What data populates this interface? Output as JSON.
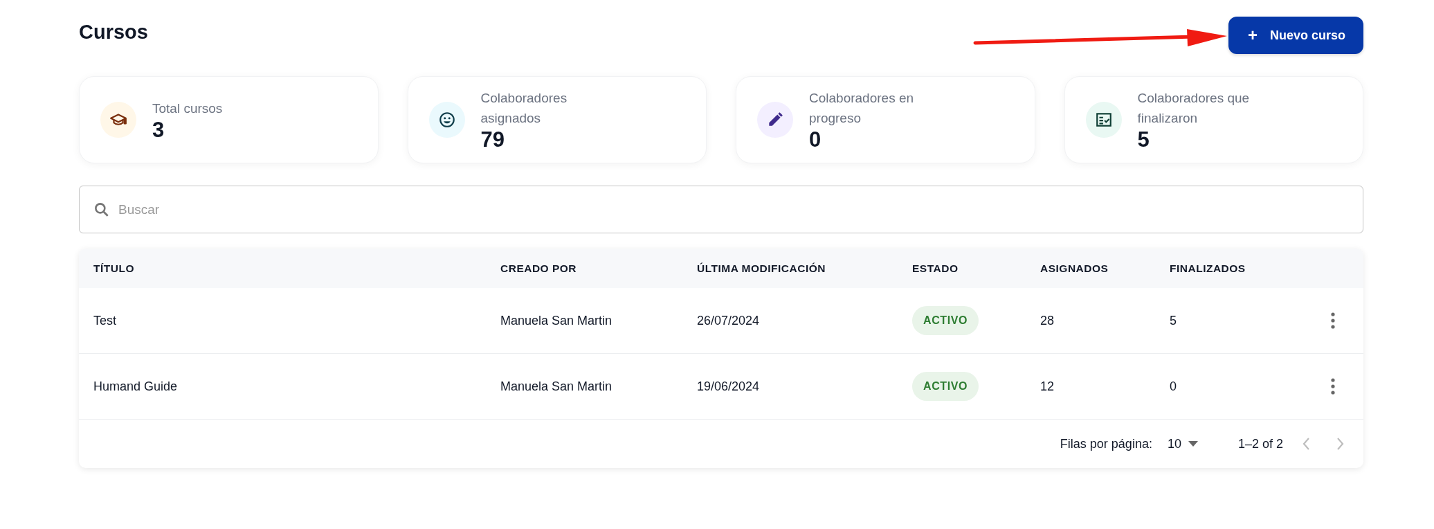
{
  "page": {
    "title": "Cursos",
    "new_button": {
      "icon": "+",
      "label": "Nuevo curso"
    }
  },
  "stats": [
    {
      "kind": "courses",
      "label": "Total cursos",
      "value": "3"
    },
    {
      "kind": "assigned",
      "label": "Colaboradores asignados",
      "value": "79"
    },
    {
      "kind": "in_progress",
      "label": "Colaboradores en progreso",
      "value": "0"
    },
    {
      "kind": "finished",
      "label": "Colaboradores que finalizaron",
      "value": "5"
    }
  ],
  "search": {
    "placeholder": "Buscar"
  },
  "table": {
    "columns": [
      "TÍTULO",
      "CREADO POR",
      "ÚLTIMA MODIFICACIÓN",
      "ESTADO",
      "ASIGNADOS",
      "FINALIZADOS"
    ],
    "rows": [
      {
        "title": "Test",
        "created_by": "Manuela San Martin",
        "modified": "26/07/2024",
        "status": "ACTIVO",
        "assigned": "28",
        "finished": "5"
      },
      {
        "title": "Humand Guide",
        "created_by": "Manuela San Martin",
        "modified": "19/06/2024",
        "status": "ACTIVO",
        "assigned": "12",
        "finished": "0"
      }
    ]
  },
  "pagination": {
    "rows_label": "Filas por página:",
    "rows_per_page": "10",
    "range": "1–2 of 2",
    "prev_disabled": true,
    "next_disabled": true
  }
}
